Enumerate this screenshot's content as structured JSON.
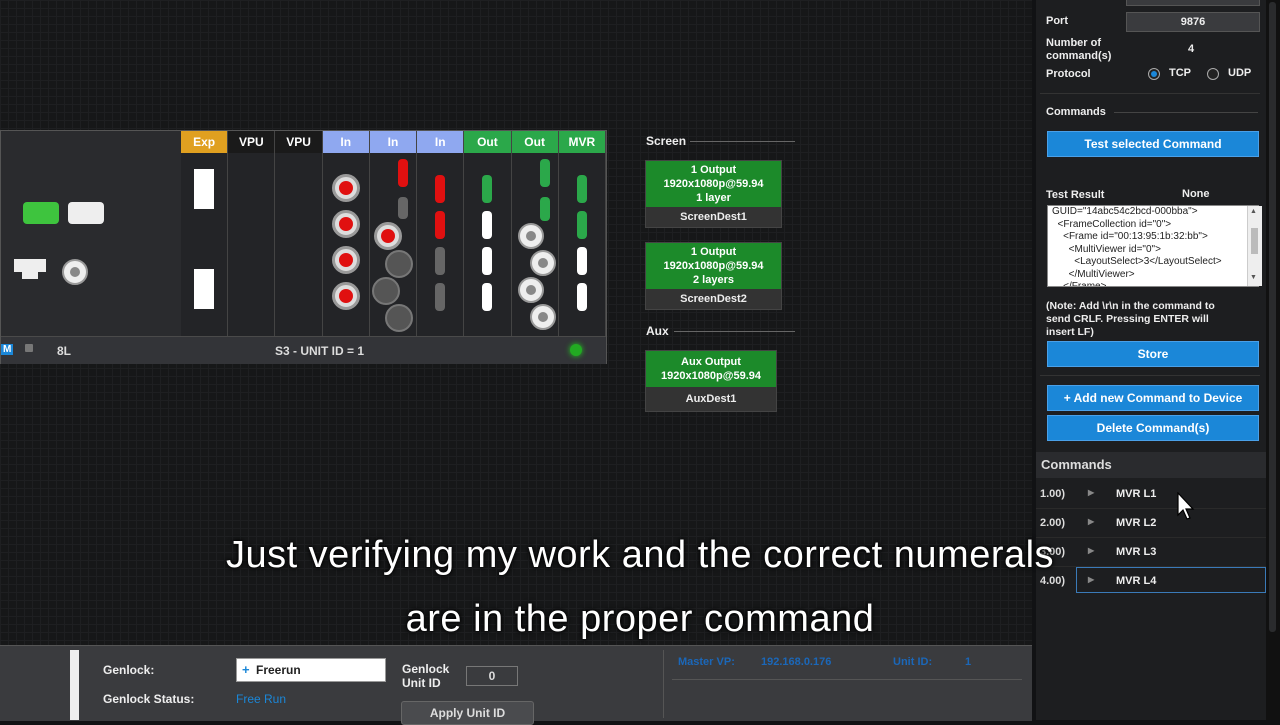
{
  "chassis": {
    "slots": [
      "Exp",
      "VPU",
      "VPU",
      "In",
      "In",
      "In",
      "Out",
      "Out",
      "MVR"
    ],
    "footer_left": "8L",
    "footer_center": "S3 - UNIT ID = 1",
    "footer_tag": "M"
  },
  "screen": {
    "section_label": "Screen",
    "dest1": {
      "line1": "1 Output",
      "line2": "1920x1080p@59.94",
      "line3": "1 layer",
      "name": "ScreenDest1"
    },
    "dest2": {
      "line1": "1 Output",
      "line2": "1920x1080p@59.94",
      "line3": "2 layers",
      "name": "ScreenDest2"
    }
  },
  "aux": {
    "section_label": "Aux",
    "dest1": {
      "line1": "Aux Output",
      "line2": "1920x1080p@59.94",
      "name": "AuxDest1"
    }
  },
  "right_panel": {
    "port_label": "Port",
    "port_value": "9876",
    "num_commands_label": "Number of command(s)",
    "num_commands_value": "4",
    "protocol_label": "Protocol",
    "protocol_tcp": "TCP",
    "protocol_udp": "UDP",
    "commands_section": "Commands",
    "test_button": "Test selected Command",
    "test_result_label": "Test Result",
    "test_result_value": "None",
    "command_text": "GUID=\"14abc54c2bcd-000bba\">\n  <FrameCollection id=\"0\">\n    <Frame id=\"00:13:95:1b:32:bb\">\n      <MultiViewer id=\"0\">\n        <LayoutSelect>3</LayoutSelect>\n      </MultiViewer>\n    </Frame>",
    "note": "(Note: Add \\r\\n in the command to send CRLF. Pressing ENTER will insert LF)",
    "store_button": "Store",
    "add_button": "+ Add new Command to Device",
    "delete_button": "Delete Command(s)",
    "commands_list_title": "Commands",
    "commands": [
      {
        "idx": "1.00)",
        "name": "MVR L1"
      },
      {
        "idx": "2.00)",
        "name": "MVR L2"
      },
      {
        "idx": "3.00)",
        "name": "MVR L3"
      },
      {
        "idx": "4.00)",
        "name": "MVR L4"
      }
    ]
  },
  "bottom": {
    "genlock_label": "Genlock:",
    "genlock_value": "Freerun",
    "genlock_status_label": "Genlock Status:",
    "genlock_status_value": "Free Run",
    "genlock_unit_label": "Genlock Unit ID",
    "genlock_unit_value": "0",
    "apply_button": "Apply Unit ID",
    "master_vp_label": "Master VP:",
    "master_vp_value": "192.168.0.176",
    "unit_id_label": "Unit ID:",
    "unit_id_value": "1"
  },
  "subtitles": {
    "line1": "Just verifying my work and the correct numerals",
    "line2": "are in the proper command"
  },
  "colors": {
    "accent_blue": "#1b87d8",
    "output_green": "#1c8a2a",
    "port_red": "#e01010",
    "exp_orange": "#e0a020",
    "in_blue": "#8fa8f0"
  }
}
